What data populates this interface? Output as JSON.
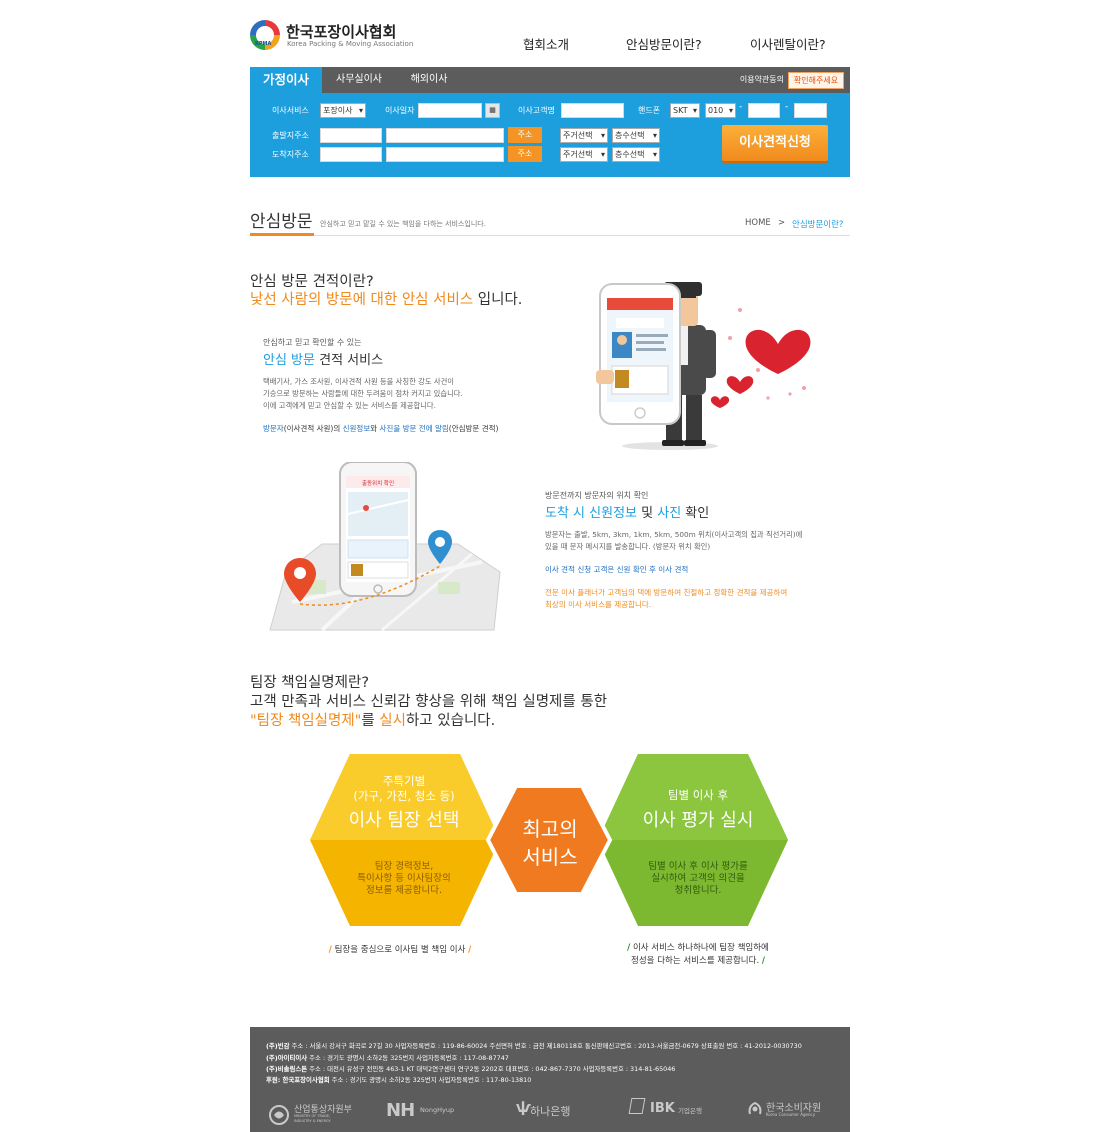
{
  "header": {
    "logo_title": "한국포장이사협회",
    "logo_sub": "Korea Packing & Moving Association",
    "logo_badge": "KPMA",
    "nav": [
      "협회소개",
      "안심방문이란?",
      "이사렌탈이란?"
    ]
  },
  "search": {
    "tabs": [
      "가정이사",
      "사무실이사",
      "해외이사"
    ],
    "terms_label": "이용약관동의",
    "confirm_label": "확인해주세요",
    "labels": {
      "service": "이사서비스",
      "date": "이사일자",
      "customer": "이사고객명",
      "phone": "핸드폰",
      "from": "출발지주소",
      "to": "도착지주소"
    },
    "service_value": "포장이사",
    "carrier_value": "SKT",
    "prefix_value": "010",
    "address_button": "주소",
    "house_type": "주거선택",
    "floor_select": "층수선택",
    "apply_button": "이사견적신청"
  },
  "page": {
    "title": "안심방문",
    "description": "안심하고 믿고 맡길 수 있는 책임을 다하는 서비스입니다.",
    "breadcrumb_home": "HOME",
    "breadcrumb_sep": ">",
    "breadcrumb_current": "안심방문이란?"
  },
  "section1": {
    "q": "안심 방문 견적이란?",
    "a_orange": "낯선 사람의 방문에 대한 안심 서비스",
    "a_rest": " 입니다.",
    "sub_small": "안심하고 믿고 확인할 수 있는",
    "sub_blue": "안심 방문",
    "sub_rest": " 견적 서비스",
    "body": [
      "택배기사, 가스 조사원, 이사견적 사원 등을 사칭한 강도 사건이",
      "기승으로 방문하는 사람들에 대한 두려움이 점차 커지고 있습니다.",
      "이에 고객에게 믿고 안심할 수 있는 서비스를 제공합니다."
    ],
    "note_a": "방문자",
    "note_b": "(이사견적 사원)의 ",
    "note_c": "신원정보",
    "note_d": "와 ",
    "note_e": "사진을 방문 전에 알림",
    "note_f": "(안심방문 견적)",
    "card_title": "Home plus",
    "card_label": "사 원 증",
    "phone_footer": "1577-0000"
  },
  "section2": {
    "sub_small": "방문전까지 방문자의 위치 확인",
    "h_a": "도착 시 신원정보",
    "h_b": " 및 ",
    "h_c": "사진",
    "h_d": " 확인",
    "body": [
      "방문자는 출발, 5km, 3km, 1km, 5km, 500m 위치(이사고객의 집과 직선거리)에",
      "있을 때 문자 메시지를 발송합니다. (방문자 위치 확인)"
    ],
    "note_blue": "이사 견적 신청 고객은 신원 확인 후 이사 견적",
    "note_orange": [
      "전문 이사 플래너가 고객님의 댁에 방문하여 친절하고 정확한 견적을 제공하여",
      "최상의 이사 서비스를 제공합니다."
    ],
    "phone_header": "출동위치 확인"
  },
  "section3": {
    "q": "팀장 책임실명제란?",
    "line2": "고객 만족과 서비스 신뢰감 향상을 위해 책임 실명제를 통한",
    "line3_orange": "\"팀장 책임실명제\"",
    "line3_mid": "를 ",
    "line3_orange2": "실시",
    "line3_rest": "하고 있습니다.",
    "left_small1": "주특기별",
    "left_small2": "(가구, 가전, 청소 등)",
    "left_big": "이사 팀장 선택",
    "left_desc": [
      "팀장 경력정보,",
      "특이사항 등 이사팀장의",
      "정보를 제공합니다."
    ],
    "center_big": [
      "최고의",
      "서비스"
    ],
    "right_small": "팀별 이사 후",
    "right_big": "이사 평가 실시",
    "right_desc": [
      "팀별 이사 후 이사 평가를",
      "실시하여 고객의 의견을",
      "청취합니다."
    ],
    "slogan_left": "팀장을 중심으로 이사팀 별 책임 이사",
    "slogan_right": [
      "이사 서비스 하나하나에 팀장 책임하에",
      "정성을 다하는 서비스를 제공합니다."
    ],
    "slash": "/"
  },
  "footer": {
    "lines": [
      {
        "b": "(주)빈감",
        "t": " 주소 : 서울시 강서구 화곡로 27길 30 사업자등록번호 : 119-86-60024 주선면허 번호 : 금천 제180118호 통신판매신고번호 : 2013-서울금천-0679 상표출원 번호 : 41-2012-0030730"
      },
      {
        "b": "(주)아이티이사",
        "t": " 주소 : 경기도 광명시 소하2동 325번지 사업자등록번호 : 117-08-87747"
      },
      {
        "b": "(주)비솔림스톤",
        "t": " 주소 : 대전시 유성구 전민동 463-1 KT 대덕2연구센터 연구2동 2202호 대표번호 : 042-867-7370 사업자등록번호 : 314-81-65046"
      },
      {
        "b": "후원: 한국포장이사협회",
        "t": " 주소 : 경기도 광명시 소하2동 325번지 사업자등록번호 : 117-80-13810"
      }
    ],
    "partners": {
      "motie": "산업통상자원부",
      "motie_sub": "MINISTRY OF TRADE, INDUSTRY & ENERGY",
      "nh": "NH",
      "nh_sub": "NongHyup",
      "hana": "하나은행",
      "ibk": "IBK",
      "ibk_sub": "기업은행",
      "kca": "한국소비자원",
      "kca_sub": "Korea Consumer Agency"
    }
  },
  "colors": {
    "blue": "#1d9fde",
    "orange": "#f08a1c",
    "dark": "#5c5c5c",
    "yellow_hex": "#f5b400",
    "orange_hex": "#f07a1f",
    "green_hex": "#7cb930"
  }
}
